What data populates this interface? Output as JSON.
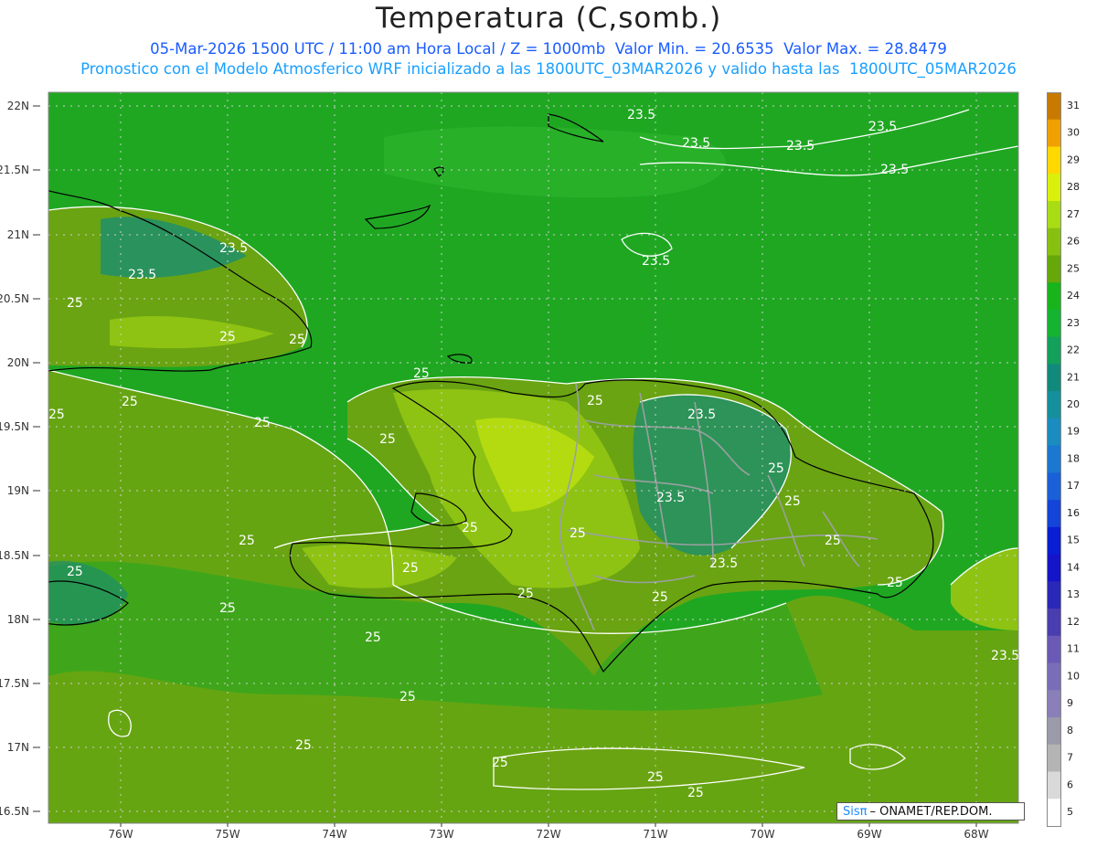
{
  "title": "Temperatura (C,somb.)",
  "subtitle_line1": "05-Mar-2026 1500 UTC / 11:00 am Hora Local / Z = 1000mb  Valor Min. = 20.6535  Valor Max. = 28.8479",
  "subtitle_line2": "Pronostico con el Modelo Atmosferico WRF inicializado a las 1800UTC_03MAR2026 y valido hasta las  1800UTC_05MAR2026",
  "credit": {
    "logo": "Sisπ",
    "text": "– ONAMET/REP.DOM."
  },
  "lat_labels": [
    "22N",
    "21.5N",
    "21N",
    "20.5N",
    "20N",
    "19.5N",
    "19N",
    "18.5N",
    "18N",
    "17.5N",
    "17N",
    "16.5N"
  ],
  "lon_labels": [
    "76W",
    "75W",
    "74W",
    "73W",
    "72W",
    "71W",
    "70W",
    "69W",
    "68W"
  ],
  "colorbar": {
    "labels": [
      "5",
      "6",
      "7",
      "8",
      "9",
      "10",
      "11",
      "12",
      "13",
      "14",
      "15",
      "16",
      "17",
      "18",
      "19",
      "20",
      "21",
      "22",
      "23",
      "24",
      "25",
      "26",
      "27",
      "28",
      "29",
      "30",
      "31"
    ],
    "colors": [
      "#ffffff",
      "#d9d9d9",
      "#b4b4b4",
      "#9a9aaa",
      "#8a7fb8",
      "#7a6db8",
      "#6a5ab6",
      "#4a3db0",
      "#2a28b8",
      "#1414c8",
      "#0a1ed4",
      "#1444d8",
      "#1a60d8",
      "#1a78d0",
      "#1a8cc0",
      "#148f9c",
      "#118a7c",
      "#12a05a",
      "#14b432",
      "#18b41c",
      "#66a80a",
      "#88c010",
      "#a8dc14",
      "#d8f00c",
      "#ffd800",
      "#f0a000",
      "#c87a00"
    ]
  },
  "contour_labels": [
    "23.5",
    "25"
  ],
  "colors": {
    "base_green": "#1fa722",
    "olive": "#6aa412",
    "light": "#8ec313",
    "yellow": "#c5e60f",
    "teal": "#1e8f6a",
    "contour": "#ffffff"
  }
}
